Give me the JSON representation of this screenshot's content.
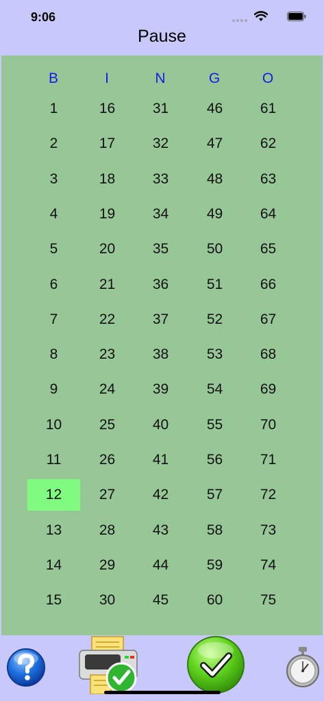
{
  "status_bar": {
    "time": "9:06"
  },
  "nav": {
    "title": "Pause"
  },
  "board": {
    "headers": [
      "B",
      "I",
      "N",
      "G",
      "O"
    ],
    "columns": [
      [
        "1",
        "2",
        "3",
        "4",
        "5",
        "6",
        "7",
        "8",
        "9",
        "10",
        "11",
        "12",
        "13",
        "14",
        "15"
      ],
      [
        "16",
        "17",
        "18",
        "19",
        "20",
        "21",
        "22",
        "23",
        "24",
        "25",
        "26",
        "27",
        "28",
        "29",
        "30"
      ],
      [
        "31",
        "32",
        "33",
        "34",
        "35",
        "36",
        "37",
        "38",
        "39",
        "40",
        "41",
        "42",
        "43",
        "44",
        "45"
      ],
      [
        "46",
        "47",
        "48",
        "49",
        "50",
        "51",
        "52",
        "53",
        "54",
        "55",
        "56",
        "57",
        "58",
        "59",
        "60"
      ],
      [
        "61",
        "62",
        "63",
        "64",
        "65",
        "66",
        "67",
        "68",
        "69",
        "70",
        "71",
        "72",
        "73",
        "74",
        "75"
      ]
    ],
    "called": [
      "12"
    ]
  },
  "toolbar": {
    "buttons": [
      {
        "icon": "help-icon"
      },
      {
        "icon": "printer-check-icon"
      },
      {
        "icon": "green-check-icon"
      },
      {
        "icon": "stopwatch-icon"
      }
    ]
  },
  "colors": {
    "background": "#c9c8fb",
    "board": "#97c796",
    "header_text": "#1a1ae6",
    "called_highlight": "#80fb7f"
  }
}
